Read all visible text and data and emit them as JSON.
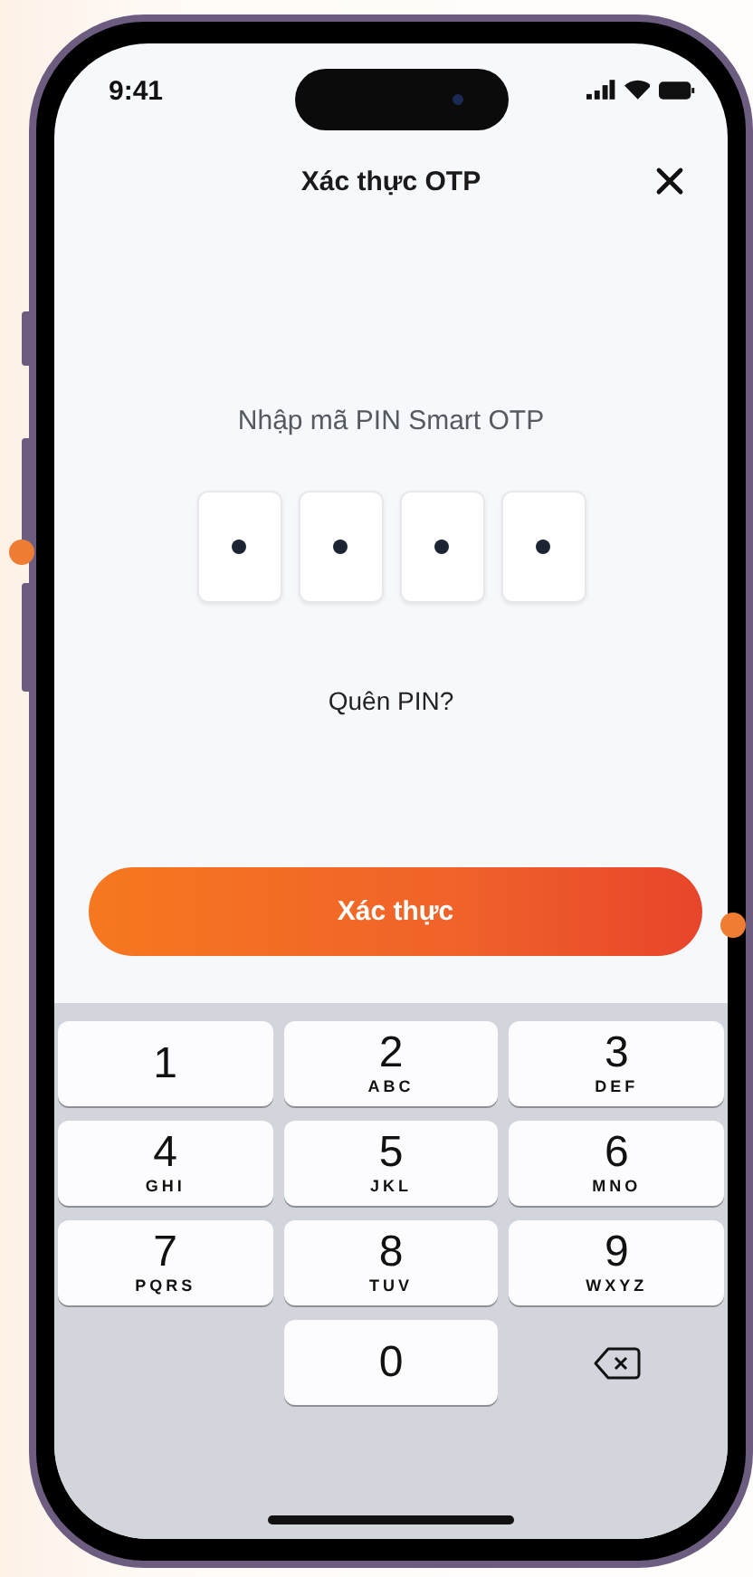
{
  "status_bar": {
    "time": "9:41"
  },
  "header": {
    "title": "Xác thực OTP"
  },
  "pin": {
    "prompt": "Nhập mã PIN Smart OTP",
    "boxes": [
      {
        "filled": true
      },
      {
        "filled": true
      },
      {
        "filled": true
      },
      {
        "filled": true
      }
    ]
  },
  "forgot_link": "Quên PIN?",
  "submit_button": "Xác thực",
  "keypad": [
    {
      "kind": "digit",
      "digit": "1"
    },
    {
      "kind": "digit",
      "digit": "2",
      "letters": "ABC"
    },
    {
      "kind": "digit",
      "digit": "3",
      "letters": "DEF"
    },
    {
      "kind": "digit",
      "digit": "4",
      "letters": "GHI"
    },
    {
      "kind": "digit",
      "digit": "5",
      "letters": "JKL"
    },
    {
      "kind": "digit",
      "digit": "6",
      "letters": "MNO"
    },
    {
      "kind": "digit",
      "digit": "7",
      "letters": "PQRS"
    },
    {
      "kind": "digit",
      "digit": "8",
      "letters": "TUV"
    },
    {
      "kind": "digit",
      "digit": "9",
      "letters": "WXYZ"
    },
    {
      "kind": "blank"
    },
    {
      "kind": "digit",
      "digit": "0"
    },
    {
      "kind": "delete"
    }
  ]
}
